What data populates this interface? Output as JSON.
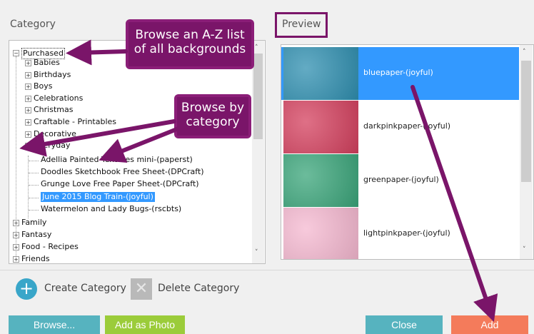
{
  "category_header": "Category",
  "preview_header": "Preview",
  "tree": {
    "root": "Purchased",
    "items": [
      "Babies",
      "Birthdays",
      "Boys",
      "Celebrations",
      "Christmas",
      "Craftable - Printables",
      "Decorative",
      "Everyday"
    ],
    "everyday_children": [
      "Adellia Painted Textures mini-(paperst)",
      "Doodles Sketchbook Free Sheet-(DPCraft)",
      "Grunge Love Free Paper Sheet-(DPCraft)",
      "June 2015 Blog Train-(joyful)",
      "Watermelon and Lady Bugs-(rscbts)"
    ],
    "after": [
      "Family",
      "Fantasy",
      "Food - Recipes",
      "Friends"
    ]
  },
  "preview_items": [
    {
      "label": "bluepaper-(joyful)",
      "color": "#2f8fb0"
    },
    {
      "label": "darkpinkpaper-(joyful)",
      "color": "#d4405e"
    },
    {
      "label": "greenpaper-(joyful)",
      "color": "#3aa57a"
    },
    {
      "label": "lightpinkpaper-(joyful)",
      "color": "#f5b8d0"
    }
  ],
  "actions": {
    "create": "Create Category",
    "delete": "Delete Category"
  },
  "buttons": {
    "browse": "Browse...",
    "add_photo": "Add as Photo",
    "close": "Close",
    "add": "Add"
  },
  "callouts": {
    "browse_az": {
      "line1": "Browse an A-Z list",
      "line2": "of all backgrounds"
    },
    "browse_cat": {
      "line1": "Browse by",
      "line2": "category"
    }
  },
  "colors": {
    "accent": "#7a1569",
    "selected": "#3399ff",
    "add": "#f47b5b",
    "close": "#56b3bf",
    "browse": "#56b3bf",
    "add_photo": "#9bcc3a"
  }
}
